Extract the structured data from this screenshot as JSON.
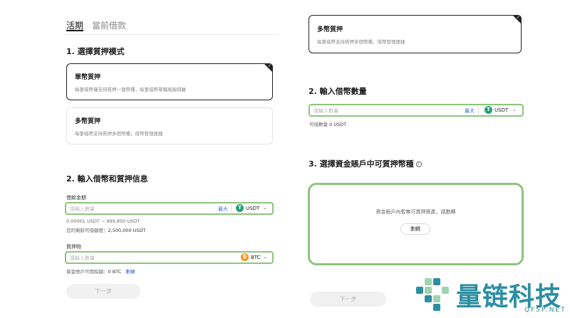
{
  "tabs": [
    {
      "label": "活期",
      "active": true
    },
    {
      "label": "當前借款",
      "active": false
    }
  ],
  "left": {
    "step1_heading": "1. 選擇質押模式",
    "modes": [
      {
        "title": "單幣質押",
        "desc": "每筆借幣僅支持質押一個幣種，每筆借幣單獨風險隔離",
        "selected": true
      },
      {
        "title": "多幣質押",
        "desc": "每筆借幣支持質押多個幣種，借幣管理便捷",
        "selected": false
      }
    ],
    "step2_heading": "2. 輸入借幣和質押信息",
    "borrow_label": "借款金額",
    "borrow_placeholder": "請輸入數量",
    "borrow_max": "最大",
    "borrow_coin": "USDT",
    "borrow_range": "0.00001 USDT ~ 999,850 USDT",
    "remaining_label": "您的剩餘可借額度：",
    "remaining_value": "2,500,000 USDT",
    "collateral_label": "質押物",
    "collateral_placeholder": "請輸入數量",
    "collateral_coin": "BTC",
    "available_label": "資金賬戶可用餘額：",
    "available_value": "0 BTC",
    "available_link": "劃轉",
    "next_label": "下一步"
  },
  "right": {
    "mode_card": {
      "title": "多幣質押",
      "desc": "每筆借幣支持質押多個幣種，借幣管理便捷"
    },
    "step2_heading": "2. 輸入借幣數量",
    "borrow_placeholder": "請輸入數量",
    "borrow_max": "最大",
    "borrow_coin": "USDT",
    "borrowable_label": "可借數量",
    "borrowable_value": "0 USDT",
    "step3_heading": "3. 選擇資金賬戶中可質押幣種",
    "empty_msg": "資金賬戶內暫無可質押資產，請劃轉",
    "refresh_label": "劃轉",
    "next_label": "下一步"
  },
  "watermark": {
    "name": "量链科技",
    "domain": "QFSP.NET"
  },
  "colors": {
    "highlight": "#8cc47b",
    "usdt": "#26a17b",
    "btc": "#f7931a",
    "link": "#3a6bd6",
    "logo": "#2b8ea1"
  },
  "icons": {
    "usdt": "tether-icon",
    "btc": "bitcoin-icon",
    "info": "info-icon",
    "chevron": "chevron-down-icon",
    "check": "check-icon"
  }
}
